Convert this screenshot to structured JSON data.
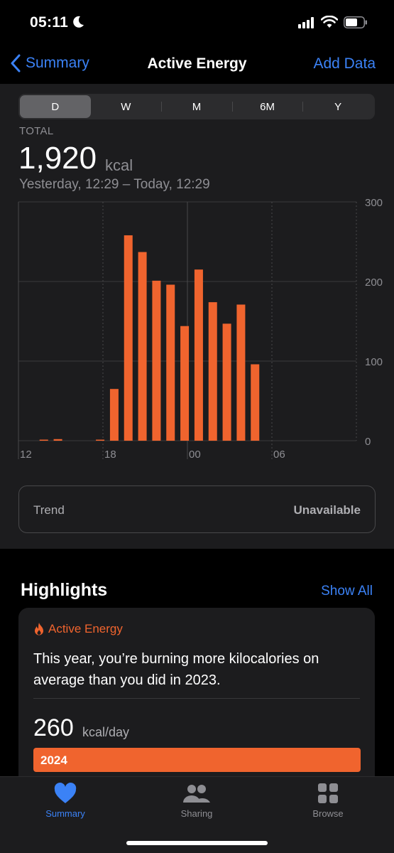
{
  "status": {
    "time": "05:11"
  },
  "nav": {
    "back_label": "Summary",
    "title": "Active Energy",
    "add_label": "Add Data"
  },
  "segments": [
    {
      "label": "D",
      "selected": true
    },
    {
      "label": "W",
      "selected": false
    },
    {
      "label": "M",
      "selected": false
    },
    {
      "label": "6M",
      "selected": false
    },
    {
      "label": "Y",
      "selected": false
    }
  ],
  "summary": {
    "total_label": "TOTAL",
    "total_value": "1,920",
    "total_unit": "kcal",
    "range": "Yesterday, 12:29 – Today, 12:29"
  },
  "chart_data": {
    "type": "bar",
    "x_tick_labels": [
      "12",
      "18",
      "00",
      "06"
    ],
    "y_tick_labels": [
      "300",
      "200",
      "100",
      "0"
    ],
    "ylim": [
      0,
      300
    ],
    "bar_color": "#f0642e",
    "hours": [
      13,
      14,
      17,
      18,
      19,
      20,
      21,
      22,
      23,
      0,
      1,
      2,
      3,
      4
    ],
    "values": [
      1,
      2,
      1,
      65,
      258,
      237,
      201,
      196,
      144,
      215,
      174,
      147,
      171,
      96
    ]
  },
  "trend": {
    "label": "Trend",
    "value": "Unavailable"
  },
  "highlights": {
    "title": "Highlights",
    "show_all": "Show All",
    "card": {
      "category": "Active Energy",
      "text": "This year, you’re burning more kilocalories on average than you did in 2023.",
      "value": "260",
      "unit": "kcal/day",
      "bar_label": "2024",
      "accent": "#f0642e"
    }
  },
  "tabbar": {
    "summary": "Summary",
    "sharing": "Sharing",
    "browse": "Browse",
    "active_color": "#3b82f6"
  }
}
